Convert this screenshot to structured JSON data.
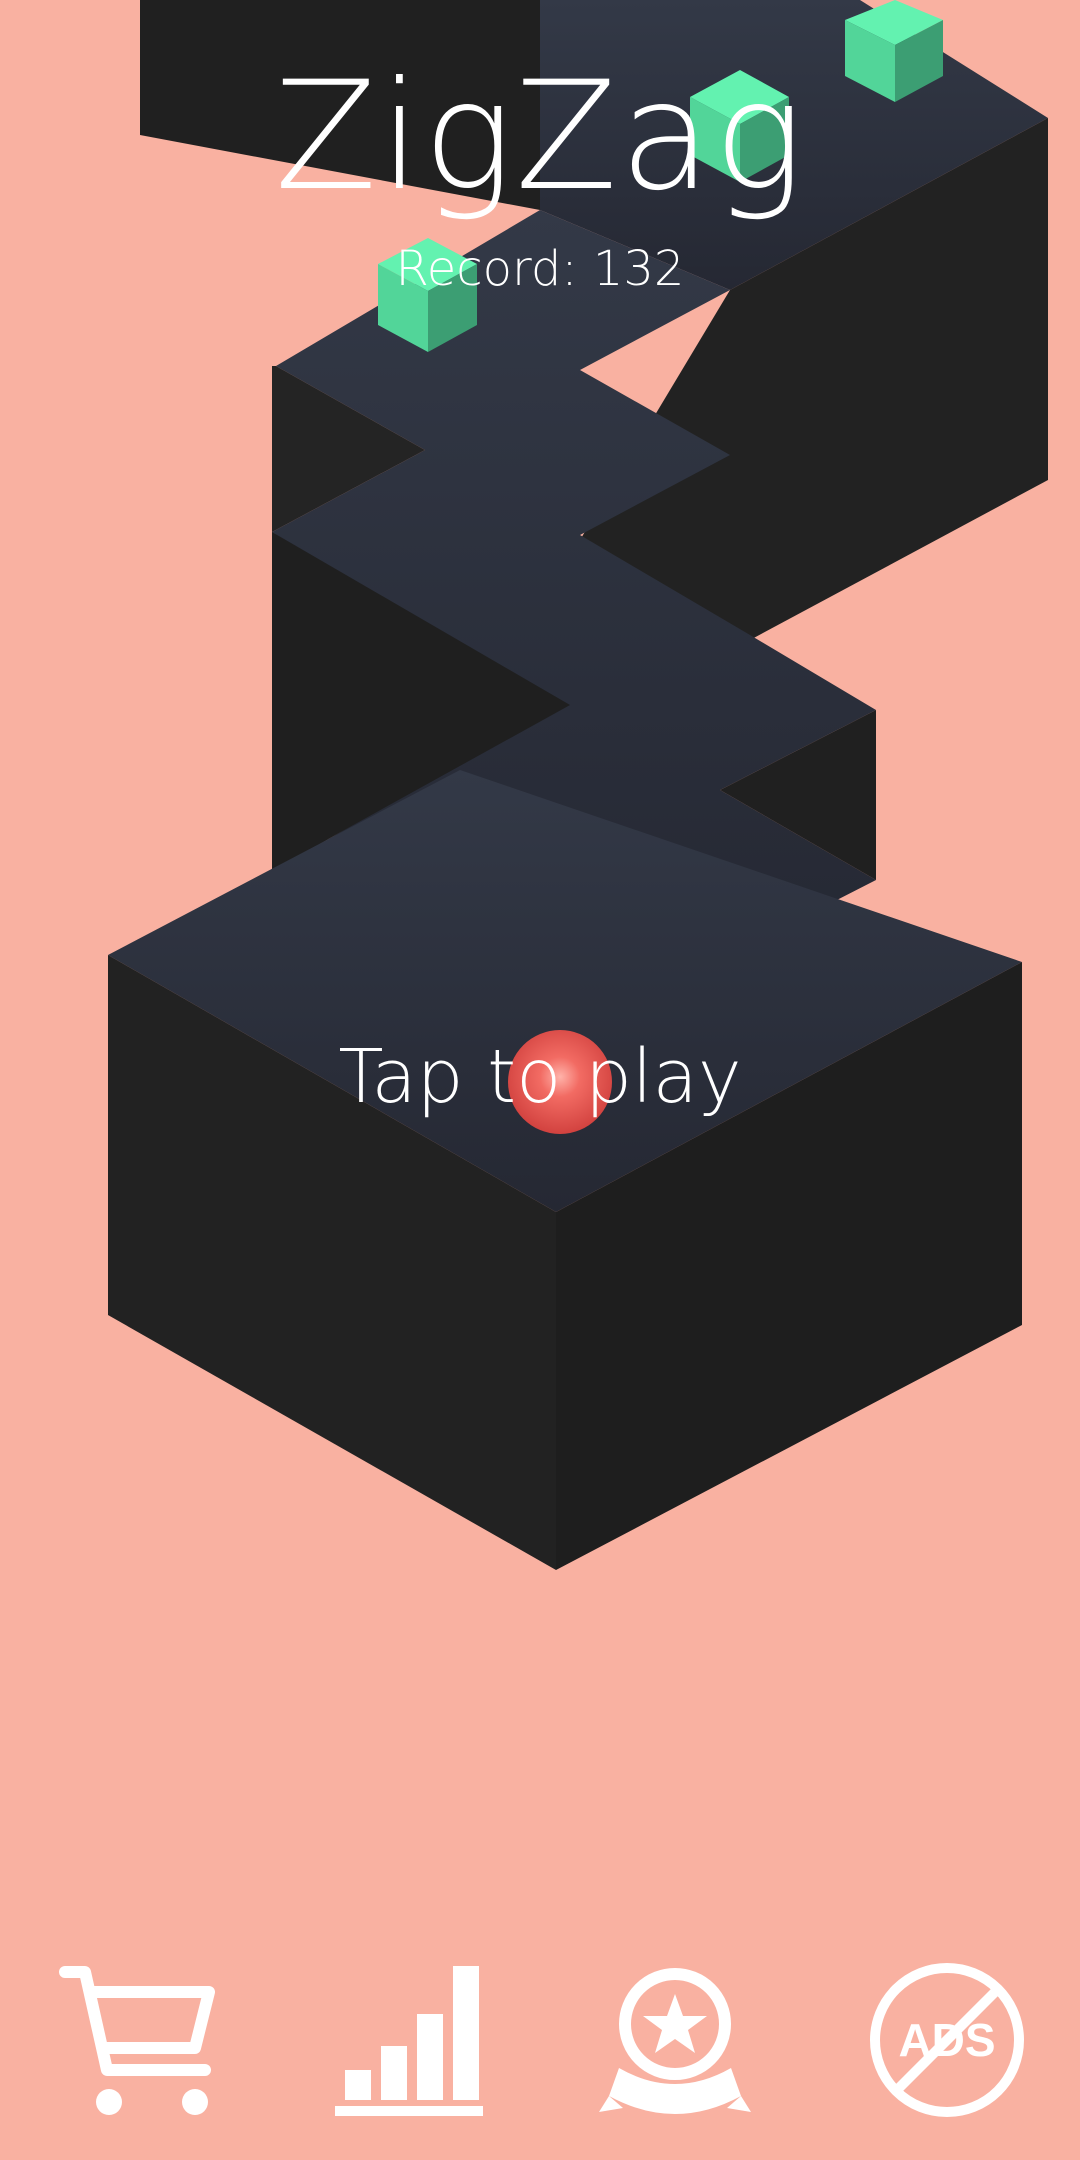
{
  "colors": {
    "background": "#F9B1A1",
    "path_top": "#2E3340",
    "path_side_dark": "#1F1F1F",
    "path_side_light": "#262626",
    "gem_top": "#63F2B0",
    "gem_left": "#52D599",
    "gem_right": "#3C9E73",
    "ball": "#E94F4F",
    "text": "#FFFFFF"
  },
  "header": {
    "title": "ZigZag",
    "record_text": "Record: 132"
  },
  "prompt": {
    "tap_text": "Tap to play"
  },
  "bottom_bar": {
    "buttons": [
      {
        "icon": "shopping-cart-icon"
      },
      {
        "icon": "leaderboard-icon"
      },
      {
        "icon": "achievement-medal-icon"
      },
      {
        "icon": "no-ads-icon",
        "label": "ADS"
      }
    ]
  }
}
